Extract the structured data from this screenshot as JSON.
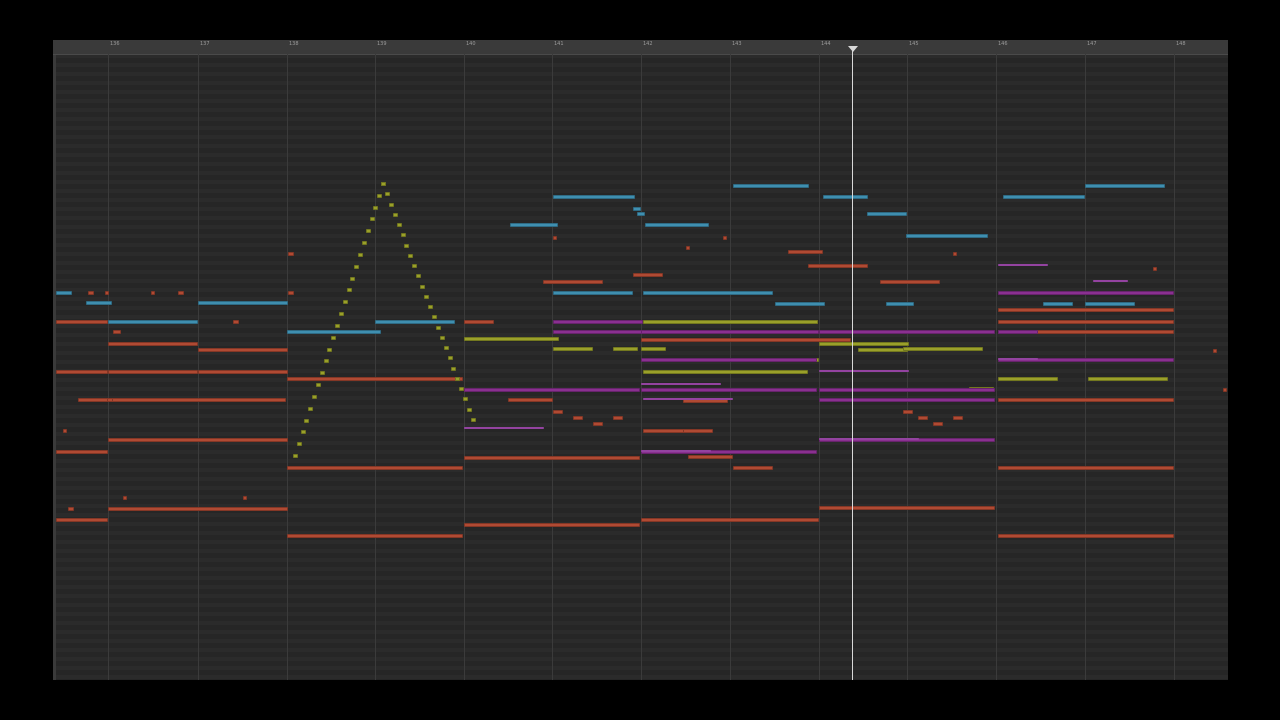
{
  "ruler": {
    "bars": [
      "136",
      "137",
      "138",
      "139",
      "140",
      "141",
      "142",
      "143",
      "144",
      "145",
      "146",
      "147",
      "148"
    ]
  },
  "colors": {
    "background": "#2a2a2a",
    "red": "#b04a33",
    "blue": "#3f8fb0",
    "green": "#9aa02a",
    "purple": "#8a3090",
    "pink": "#c45ad6",
    "playhead": "#d8d8d8"
  }
}
